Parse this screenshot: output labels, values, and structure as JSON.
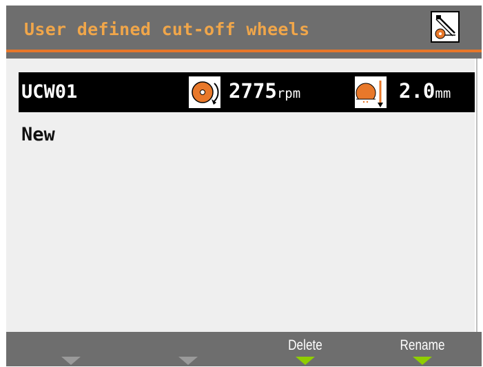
{
  "header": {
    "title": "User defined cut-off wheels",
    "mode_icon": "wheel-edit-icon"
  },
  "list": {
    "items": [
      {
        "name": "UCW01",
        "speed_icon": "wheel-rotation-icon",
        "speed_value": "2775",
        "speed_unit": "rpm",
        "depth_icon": "wheel-depth-icon",
        "depth_value": "2.0",
        "depth_unit": "mm",
        "selected": true
      },
      {
        "name": "New",
        "selected": false
      }
    ]
  },
  "softkeys": [
    {
      "label": "",
      "active": false
    },
    {
      "label": "",
      "active": false
    },
    {
      "label": "Delete",
      "active": true
    },
    {
      "label": "Rename",
      "active": true
    }
  ],
  "colors": {
    "accent": "#e8782a",
    "title_text": "#f0a64a",
    "softkey_active": "#8fce00",
    "softkey_inactive": "#9a9a9a",
    "selection": "#000000"
  }
}
